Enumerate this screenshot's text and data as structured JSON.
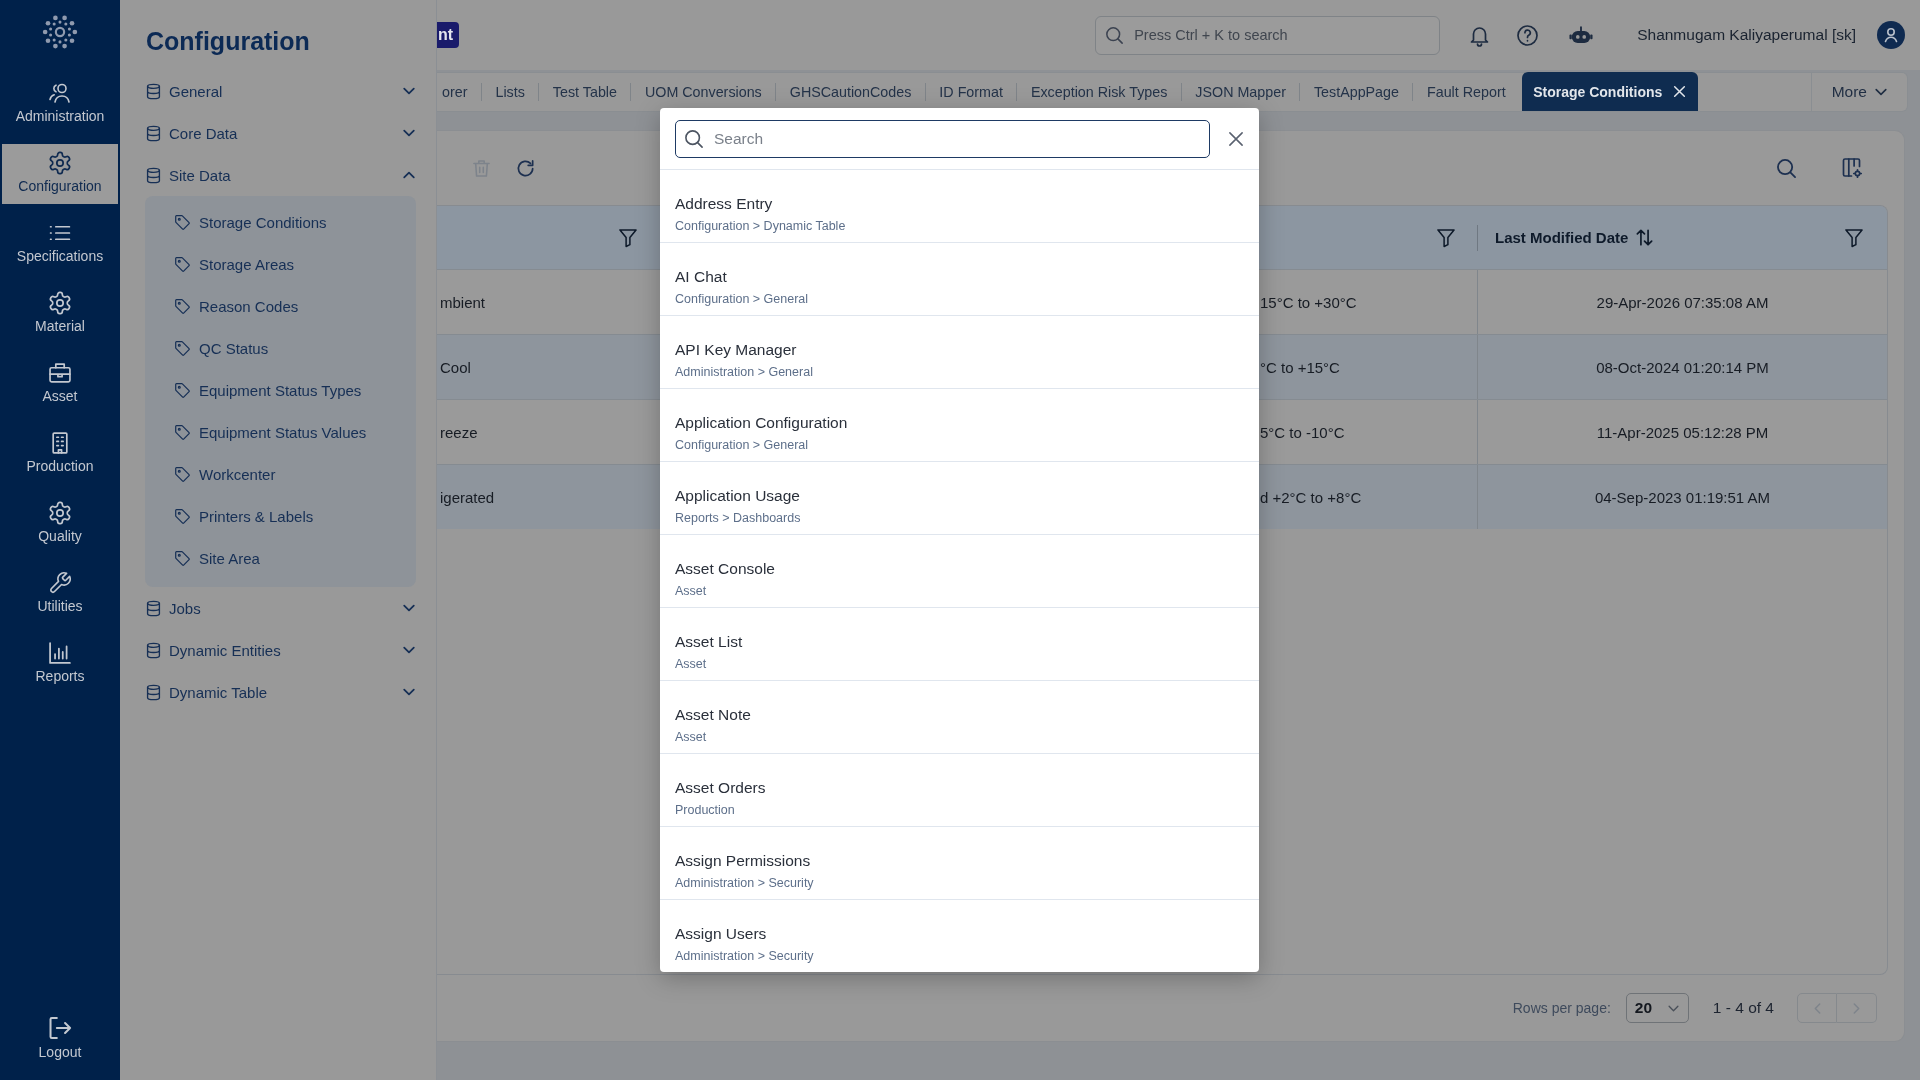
{
  "sidebar": {
    "items": [
      {
        "label": "Administration",
        "selected": false
      },
      {
        "label": "Configuration",
        "selected": true
      },
      {
        "label": "Specifications",
        "selected": false
      },
      {
        "label": "Material",
        "selected": false
      },
      {
        "label": "Asset",
        "selected": false
      },
      {
        "label": "Production",
        "selected": false
      },
      {
        "label": "Quality",
        "selected": false
      },
      {
        "label": "Utilities",
        "selected": false
      },
      {
        "label": "Reports",
        "selected": false
      }
    ],
    "logout": "Logout"
  },
  "config_panel": {
    "title": "Configuration",
    "groups": [
      {
        "label": "General",
        "expanded": false
      },
      {
        "label": "Core Data",
        "expanded": false
      },
      {
        "label": "Site Data",
        "expanded": true,
        "children": [
          {
            "label": "Storage Conditions"
          },
          {
            "label": "Storage Areas"
          },
          {
            "label": "Reason Codes"
          },
          {
            "label": "QC Status"
          },
          {
            "label": "Equipment Status Types"
          },
          {
            "label": "Equipment Status Values"
          },
          {
            "label": "Workcenter"
          },
          {
            "label": "Printers & Labels"
          },
          {
            "label": "Site Area"
          }
        ]
      },
      {
        "label": "Jobs",
        "expanded": false
      },
      {
        "label": "Dynamic Entities",
        "expanded": false
      },
      {
        "label": "Dynamic Table",
        "expanded": false
      }
    ]
  },
  "header": {
    "badge": "nt",
    "search": {
      "placeholder": "Press Ctrl + K to search"
    },
    "user_name": "Shanmugam Kaliyaperumal [sk]"
  },
  "tabs": [
    {
      "label": "orer",
      "selected": false
    },
    {
      "label": "Lists",
      "selected": false
    },
    {
      "label": "Test Table",
      "selected": false
    },
    {
      "label": "UOM Conversions",
      "selected": false
    },
    {
      "label": "GHSCautionCodes",
      "selected": false
    },
    {
      "label": "ID Format",
      "selected": false
    },
    {
      "label": "Exception Risk Types",
      "selected": false
    },
    {
      "label": "JSON Mapper",
      "selected": false
    },
    {
      "label": "TestAppPage",
      "selected": false
    },
    {
      "label": "Fault Report",
      "selected": false
    },
    {
      "label": "Storage Conditions",
      "selected": true
    }
  ],
  "more_button": "More",
  "toolbar": {
    "delete_disabled": true
  },
  "table": {
    "last_modified_date_label": "Last Modified Date",
    "rows": [
      {
        "column_1": "mbient",
        "column_3": "15°C to +30°C",
        "last_modified_date": "29-Apr-2026 07:35:08 AM"
      },
      {
        "column_1": "Cool",
        "column_3": "°C to +15°C",
        "last_modified_date": "08-Oct-2024 01:20:14 PM"
      },
      {
        "column_1": "reeze",
        "column_3": "5°C to -10°C",
        "last_modified_date": "11-Apr-2025 05:12:28 PM"
      },
      {
        "column_1": "igerated",
        "column_3": "d +2°C to +8°C",
        "last_modified_date": "04-Sep-2023 01:19:51 AM"
      }
    ]
  },
  "pagination": {
    "label": "Rows per page:",
    "rows_per_page": "20",
    "range": "1 - 4 of 4"
  },
  "search_modal": {
    "search": {
      "placeholder": "Search"
    },
    "results": [
      {
        "title": "Address Entry",
        "path": "Configuration > Dynamic Table"
      },
      {
        "title": "AI Chat",
        "path": "Configuration > General"
      },
      {
        "title": "API Key Manager",
        "path": "Administration > General"
      },
      {
        "title": "Application Configuration",
        "path": "Configuration > General"
      },
      {
        "title": "Application Usage",
        "path": "Reports > Dashboards"
      },
      {
        "title": "Asset Console",
        "path": "Asset"
      },
      {
        "title": "Asset List",
        "path": "Asset"
      },
      {
        "title": "Asset Note",
        "path": "Asset"
      },
      {
        "title": "Asset Orders",
        "path": "Production"
      },
      {
        "title": "Assign Permissions",
        "path": "Administration > Security"
      },
      {
        "title": "Assign Users",
        "path": "Administration > Security"
      }
    ]
  }
}
